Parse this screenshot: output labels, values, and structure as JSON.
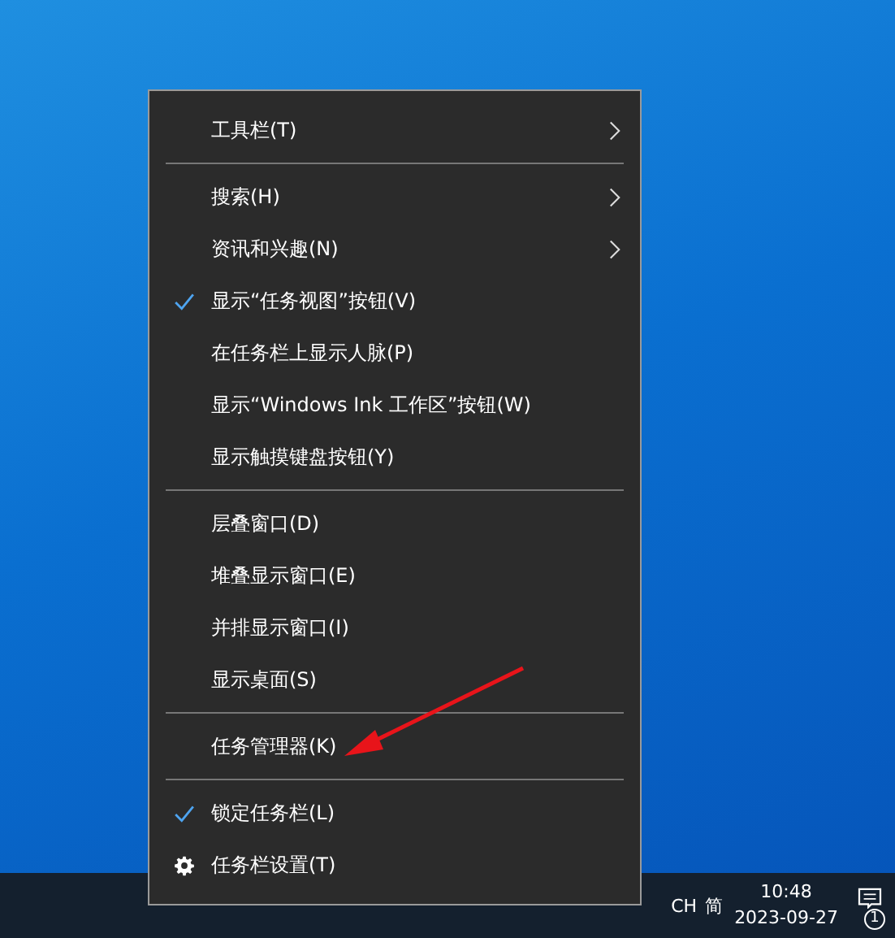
{
  "context_menu": {
    "items": [
      {
        "kind": "submenu",
        "label": "工具栏(T)"
      },
      {
        "kind": "separator"
      },
      {
        "kind": "submenu",
        "label": "搜索(H)"
      },
      {
        "kind": "submenu",
        "label": "资讯和兴趣(N)"
      },
      {
        "kind": "toggle",
        "label": "显示“任务视图”按钮(V)",
        "checked": true
      },
      {
        "kind": "toggle",
        "label": "在任务栏上显示人脉(P)",
        "checked": false
      },
      {
        "kind": "toggle",
        "label": "显示“Windows Ink 工作区”按钮(W)",
        "checked": false
      },
      {
        "kind": "toggle",
        "label": "显示触摸键盘按钮(Y)",
        "checked": false
      },
      {
        "kind": "separator"
      },
      {
        "kind": "command",
        "label": "层叠窗口(D)"
      },
      {
        "kind": "command",
        "label": "堆叠显示窗口(E)"
      },
      {
        "kind": "command",
        "label": "并排显示窗口(I)"
      },
      {
        "kind": "command",
        "label": "显示桌面(S)"
      },
      {
        "kind": "separator"
      },
      {
        "kind": "command",
        "label": "任务管理器(K)"
      },
      {
        "kind": "separator"
      },
      {
        "kind": "toggle",
        "label": "锁定任务栏(L)",
        "checked": true
      },
      {
        "kind": "settings",
        "label": "任务栏设置(T)"
      }
    ]
  },
  "taskbar": {
    "input_language": "CH",
    "input_mode": "简",
    "time": "10:48",
    "date": "2023-09-27",
    "notification_count": "1"
  }
}
